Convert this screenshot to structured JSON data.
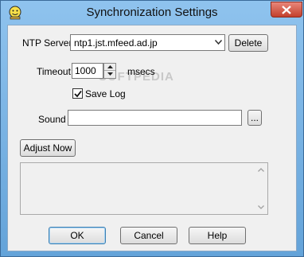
{
  "window": {
    "title": "Synchronization Settings"
  },
  "ntp": {
    "label": "NTP Server",
    "value": "ntp1.jst.mfeed.ad.jp",
    "delete_label": "Delete"
  },
  "timeout": {
    "label": "Timeout",
    "value": "1000",
    "unit": "msecs"
  },
  "save_log": {
    "label": "Save Log",
    "checked": true
  },
  "sound": {
    "label": "Sound",
    "value": "",
    "browse_label": "..."
  },
  "adjust_now_label": "Adjust Now",
  "log_text": "",
  "buttons": {
    "ok": "OK",
    "cancel": "Cancel",
    "help": "Help"
  },
  "watermark": "SOFTPEDIA",
  "colors": {
    "titlebar": "#8fc3ee",
    "client": "#f0f0f0",
    "close": "#c3402d",
    "default_button_border": "#3c7fb1"
  },
  "icons": {
    "app": "smiley-icon",
    "close": "close-icon",
    "combo_arrow": "chevron-down-icon",
    "spin_up": "spin-up-icon",
    "spin_down": "spin-down-icon",
    "check": "checkmark-icon",
    "scroll_up": "scroll-up-arrow-icon",
    "scroll_down": "scroll-down-arrow-icon"
  }
}
